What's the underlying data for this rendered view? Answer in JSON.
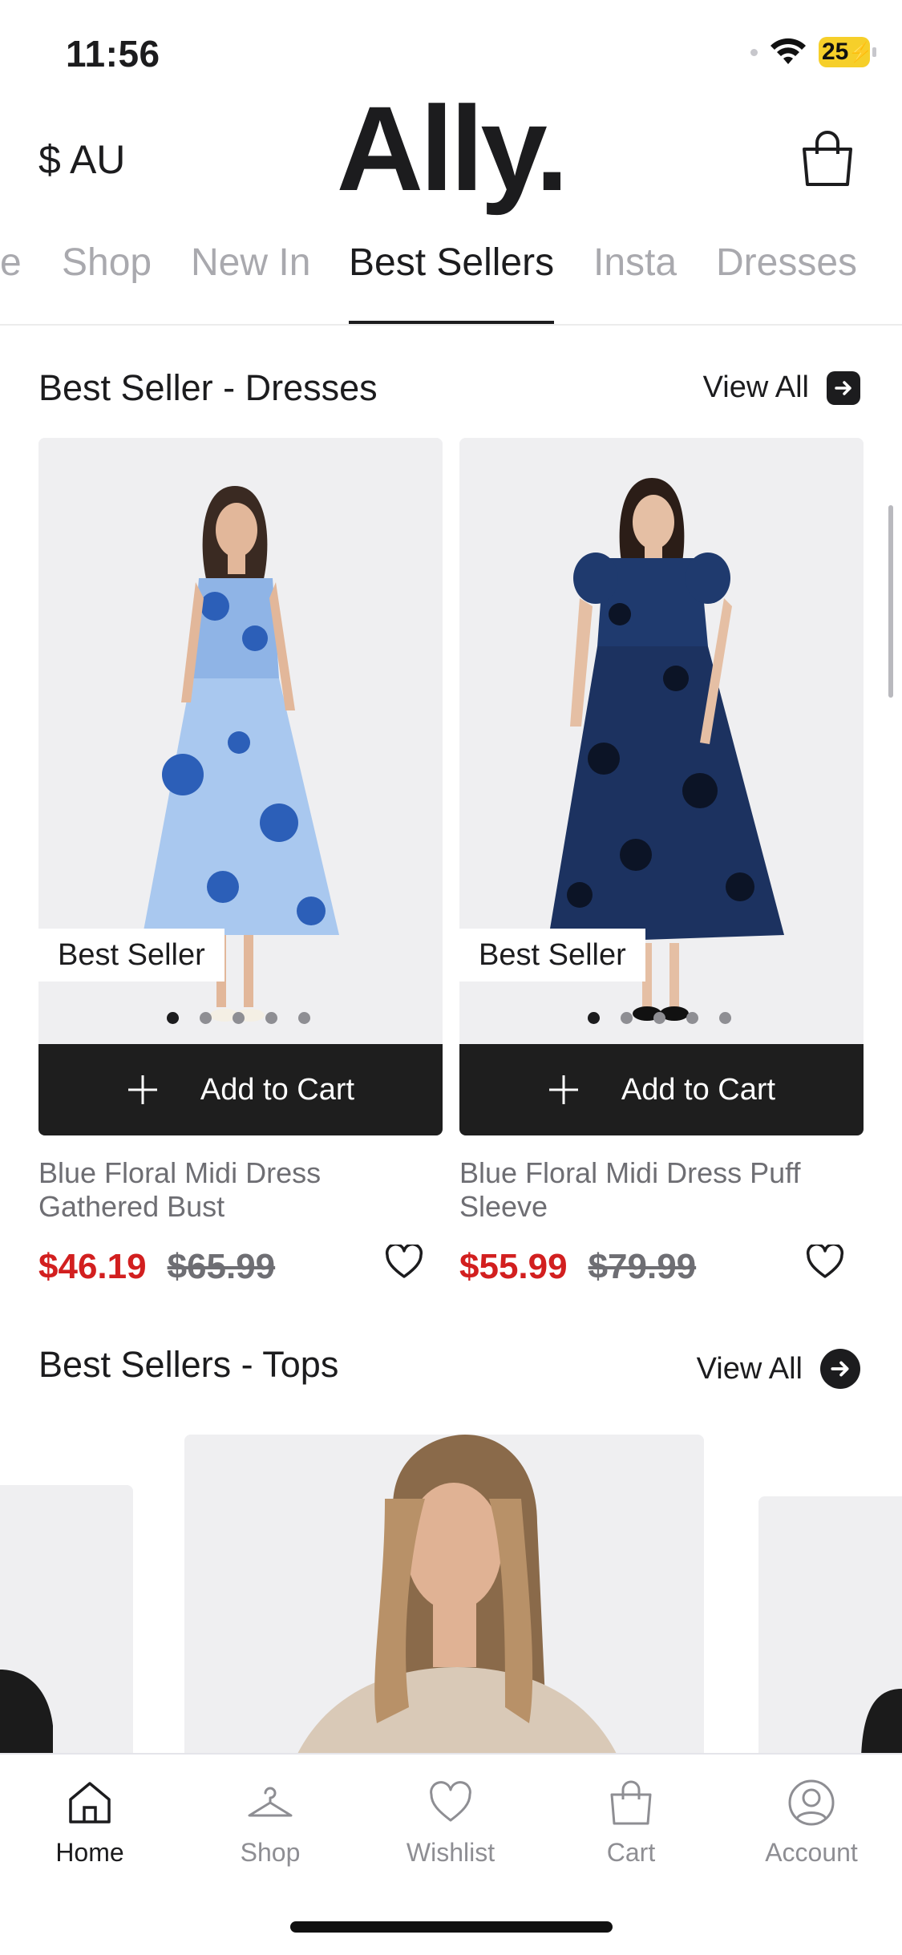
{
  "status": {
    "time": "11:56",
    "battery": "25"
  },
  "header": {
    "currency": "$ AU",
    "logo": "Ally.",
    "bag_icon": "shopping-bag-icon"
  },
  "tabs": [
    {
      "label": "e"
    },
    {
      "label": "Shop"
    },
    {
      "label": "New In"
    },
    {
      "label": "Best Sellers",
      "active": true
    },
    {
      "label": "Insta"
    },
    {
      "label": "Dresses"
    }
  ],
  "dresses_section": {
    "title": "Best Seller - Dresses",
    "view_all": "View All",
    "products": [
      {
        "badge": "Best Seller",
        "add_to_cart": "Add to Cart",
        "name_line1": "Blue Floral Midi Dress",
        "name_line2": "Gathered Bust",
        "price": "$46.19",
        "old_price": "$65.99",
        "image_total": 5,
        "image_index": 1
      },
      {
        "badge": "Best Seller",
        "add_to_cart": "Add to Cart",
        "name_line1": "Blue Floral Midi Dress Puff",
        "name_line2": "Sleeve",
        "price": "$55.99",
        "old_price": "$79.99",
        "image_total": 5,
        "image_index": 1
      }
    ]
  },
  "tops_section": {
    "title": "Best Sellers - Tops",
    "view_all": "View All"
  },
  "tabbar": [
    {
      "label": "Home",
      "icon": "home-icon",
      "active": true
    },
    {
      "label": "Shop",
      "icon": "hanger-icon"
    },
    {
      "label": "Wishlist",
      "icon": "heart-icon"
    },
    {
      "label": "Cart",
      "icon": "bag-icon"
    },
    {
      "label": "Account",
      "icon": "person-icon"
    }
  ],
  "colors": {
    "sale_price": "#d21f1f",
    "button_bg": "#1e1e1e",
    "battery": "#f6cf2a"
  }
}
